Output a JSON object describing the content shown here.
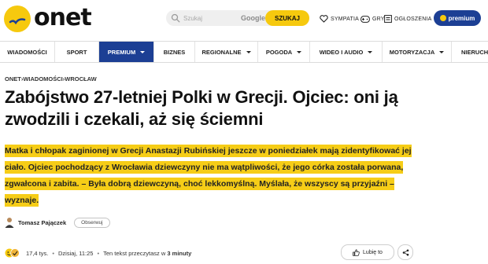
{
  "header": {
    "logo_text": "onet",
    "search": {
      "placeholder": "Szukaj",
      "google_label": "Google",
      "button_label": "SZUKAJ"
    },
    "links": {
      "sympatia": "SYMPATIA",
      "gry": "GRY",
      "ogloszenia": "OGŁOSZENIA"
    },
    "premium_label": "premium"
  },
  "nav": {
    "items": [
      {
        "label": "WIADOMOŚCI"
      },
      {
        "label": "SPORT"
      },
      {
        "label": "PREMIUM"
      },
      {
        "label": "BIZNES"
      },
      {
        "label": "REGIONALNE"
      },
      {
        "label": "POGODA"
      },
      {
        "label": "WIDEO I AUDIO"
      },
      {
        "label": "MOTORYZACJA"
      },
      {
        "label": "NIERUCHO"
      }
    ]
  },
  "breadcrumb": [
    "ONET",
    "WIADOMOŚCI",
    "WROCŁAW"
  ],
  "article": {
    "title": "Zabójstwo 27-letniej Polki w Grecji. Ojciec: oni ją zwodzili i czekali, aż się ściemni",
    "lead": "Matka i chłopak zaginionej w Grecji Anastazji Rubińskiej jeszcze w poniedziałek mają zidentyfikować jej ciało. Ojciec pochodzący z Wrocławia dziewczyny nie ma wątpliwości, że jego córka została porwana, zgwałcona i zabita. – Była dobrą dziewczyną, choć lekkomyślną. Myślała, że wszyscy są przyjaźni – wyznaje.",
    "author": "Tomasz Pajączek",
    "follow_label": "Obserwuj",
    "reactions": "17,4 tys.",
    "date": "Dzisiaj, 11:25",
    "read_time_prefix": "Ten tekst przeczytasz w",
    "read_time_value": "3 minuty",
    "like_label": "Lubię to"
  },
  "colors": {
    "brand_yellow": "#f6c90e",
    "brand_blue": "#1c3f94",
    "highlight": "#f6cd17"
  }
}
